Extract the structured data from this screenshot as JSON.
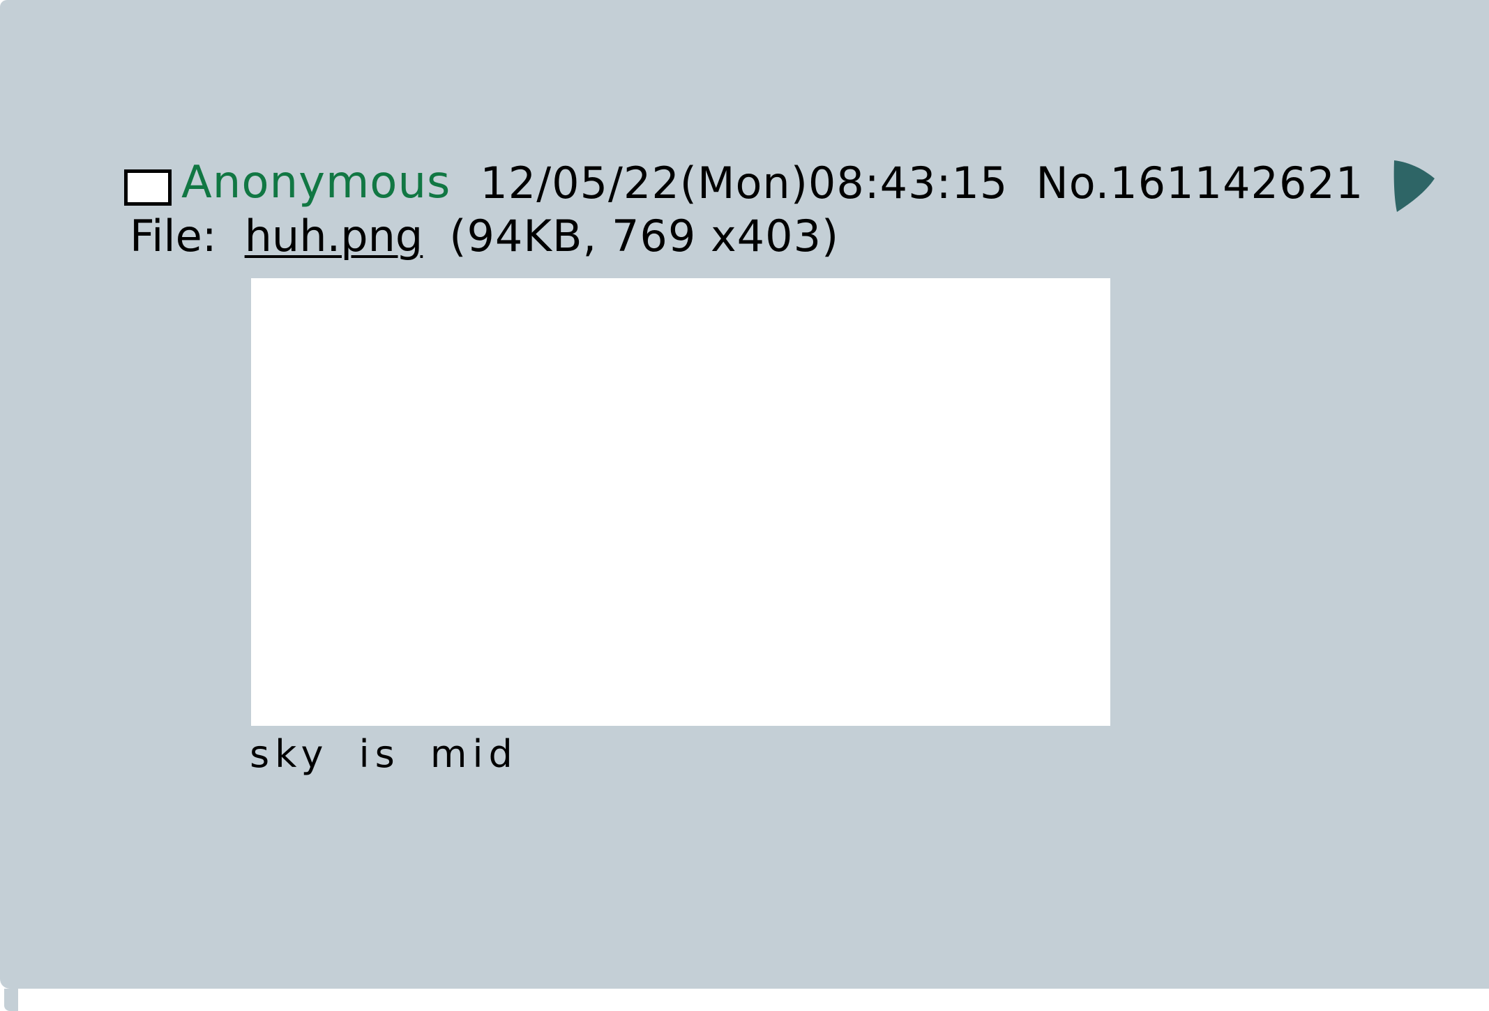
{
  "post": {
    "poster_name": "Anonymous",
    "date": "12/05/22(Mon)08:43:15",
    "number": "No.161142621",
    "file": {
      "label": "File:",
      "filename": "huh.png",
      "meta": "(94KB, 769 x403)"
    },
    "comment": "sky is mid"
  },
  "icons": {
    "menu": "play-triangle-icon"
  },
  "colors": {
    "panel_bg": "#c4cfd6",
    "poster_name": "#117743",
    "menu_arrow": "#2e6566",
    "image_bg": "#ffffff"
  }
}
